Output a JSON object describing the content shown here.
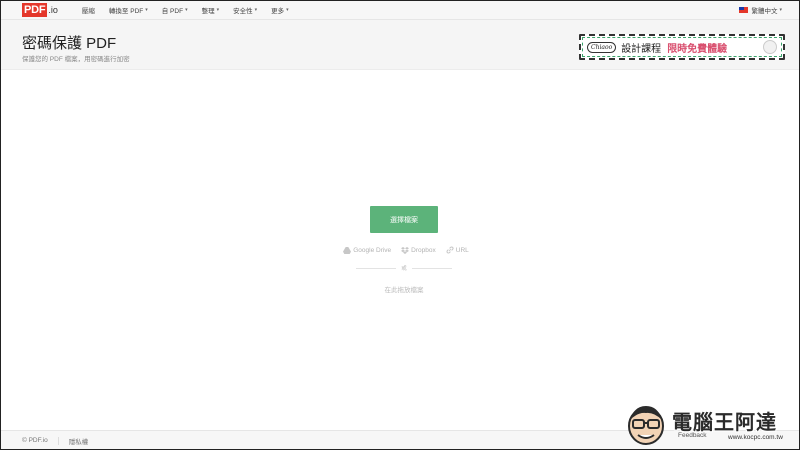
{
  "nav": {
    "logo_main": "PDF",
    "logo_suffix": ".io",
    "items": [
      {
        "label": "壓縮",
        "has_menu": false
      },
      {
        "label": "轉換至 PDF",
        "has_menu": true
      },
      {
        "label": "自 PDF",
        "has_menu": true
      },
      {
        "label": "整理",
        "has_menu": true
      },
      {
        "label": "安全性",
        "has_menu": true
      },
      {
        "label": "更多",
        "has_menu": true
      }
    ],
    "caret": "▾",
    "language": "繁體中文"
  },
  "header": {
    "title": "密碼保護 PDF",
    "subtitle": "保護您的 PDF 檔案，用密碼進行加密"
  },
  "ad": {
    "badge": "Chiaoo",
    "main_text": "設計課程",
    "promo_text": "限時免費體驗"
  },
  "upload": {
    "select_button": "選擇檔案",
    "sources": [
      {
        "label": "Google Drive",
        "icon": "google-drive-icon"
      },
      {
        "label": "Dropbox",
        "icon": "dropbox-icon"
      },
      {
        "label": "URL",
        "icon": "link-icon"
      }
    ],
    "or_text": "或",
    "drop_text": "在此拖放檔案"
  },
  "footer": {
    "copyright": "© PDF.io",
    "privacy": "隱私權",
    "feedback": "Feedback"
  },
  "watermark": {
    "brand": "電腦王阿達",
    "url": "www.kocpc.com.tw"
  },
  "colors": {
    "accent_green": "#5cb37a",
    "logo_red": "#e4372b",
    "header_bg": "#f5f5f5"
  }
}
